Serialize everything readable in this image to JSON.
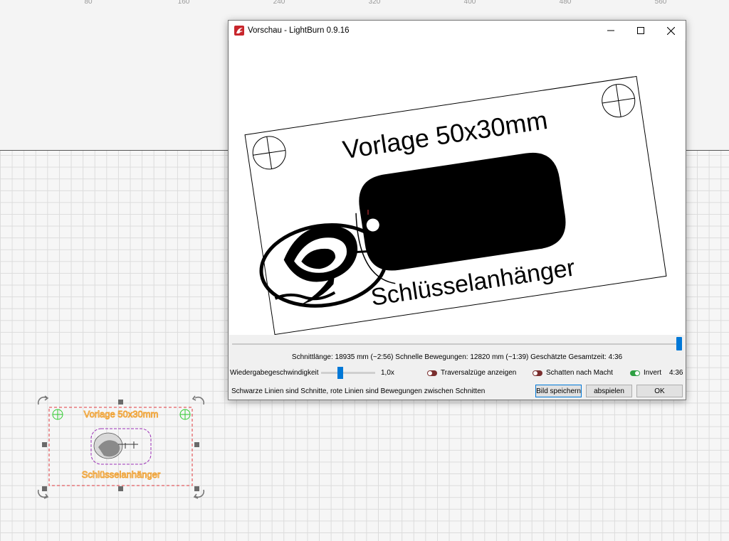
{
  "ruler": {
    "ticks": [
      "80",
      "160",
      "240",
      "320",
      "400",
      "480",
      "560"
    ]
  },
  "design": {
    "top_text": "Vorlage 50x30mm",
    "bottom_text": "Schlüsselanhänger"
  },
  "window": {
    "title": "Vorschau - LightBurn 0.9.16",
    "minimize_icon": "minimize-icon",
    "maximize_icon": "maximize-icon",
    "close_icon": "close-icon"
  },
  "preview": {
    "title_text": "Vorlage 50x30mm",
    "subtitle_text": "Schlüsselanhänger",
    "scrub_position": 1.0
  },
  "stats": {
    "text": "Schnittlänge: 18935 mm (~2:56) Schnelle Bewegungen: 12820 mm (~1:39) Geschätzte Gesamtzeit: 4:36"
  },
  "controls": {
    "speed_label": "Wiedergabegeschwindigkeit",
    "speed_value": "1,0x",
    "speed_level": 0.35,
    "traversal_label": "Traversalzüge anzeigen",
    "traversal_on": false,
    "shading_label": "Schatten nach Macht",
    "shading_on": false,
    "invert_label": "Invert",
    "invert_on": true,
    "time": "4:36"
  },
  "footer": {
    "hint": "Schwarze Linien sind Schnitte, rote Linien sind Bewegungen zwischen Schnitten",
    "save_label": "Bild speichern",
    "play_label": "abspielen",
    "ok_label": "OK"
  },
  "colors": {
    "accent": "#0078d7",
    "selection": "#e0393e",
    "text_orange": "#f0a030",
    "toggle_off": "#7a2f2f",
    "toggle_on": "#2ea043"
  }
}
